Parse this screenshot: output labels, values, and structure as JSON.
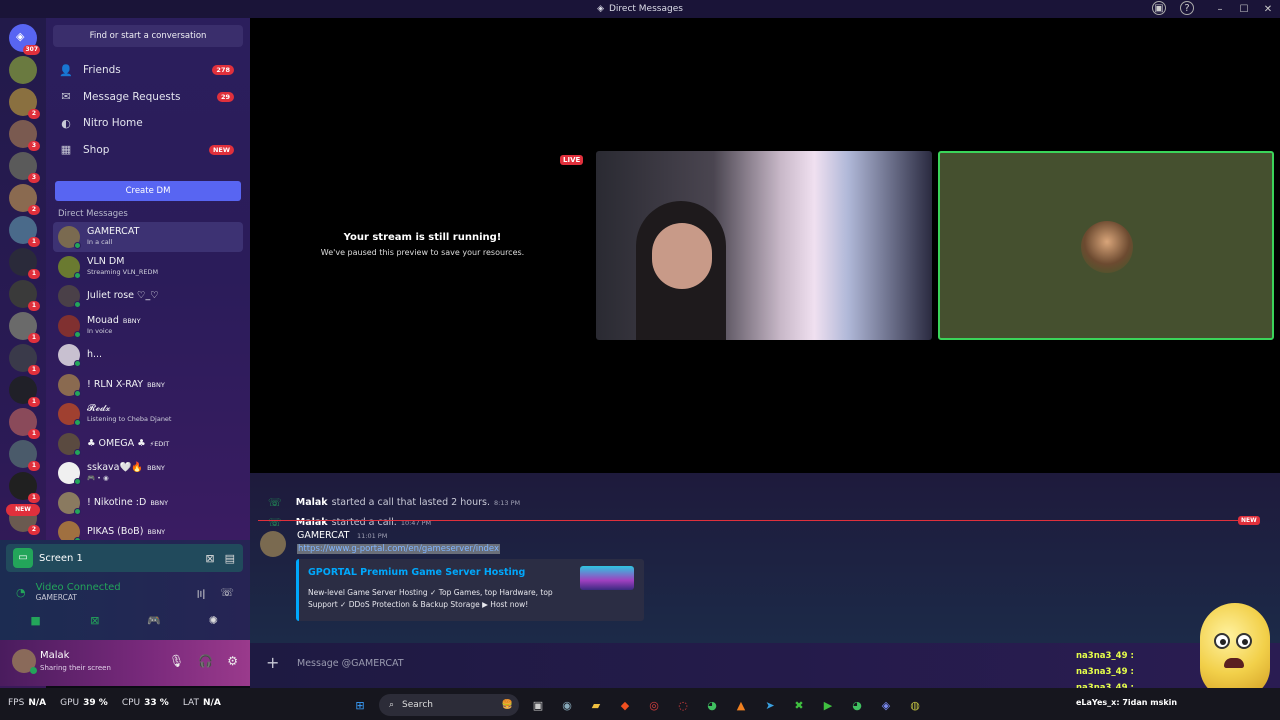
{
  "window": {
    "title": "Direct Messages"
  },
  "rail": {
    "home_badge": "307",
    "servers": [
      {
        "badge": ""
      },
      {
        "badge": "2"
      },
      {
        "badge": "3"
      },
      {
        "badge": "3"
      },
      {
        "badge": "2"
      },
      {
        "badge": "1"
      },
      {
        "badge": "1"
      },
      {
        "badge": "1"
      },
      {
        "badge": "1"
      },
      {
        "badge": "1"
      },
      {
        "badge": "1"
      },
      {
        "badge": "1"
      },
      {
        "badge": "1"
      },
      {
        "badge": "1"
      },
      {
        "badge": "2"
      }
    ],
    "new_label": "NEW"
  },
  "sidebar": {
    "search_label": "Find or start a conversation",
    "nav": [
      {
        "label": "Friends",
        "icon": "friends-icon",
        "badge": "278"
      },
      {
        "label": "Message Requests",
        "icon": "mail-icon",
        "badge": "29"
      },
      {
        "label": "Nitro Home",
        "icon": "nitro-icon",
        "badge": ""
      },
      {
        "label": "Shop",
        "icon": "shop-icon",
        "badge": "NEW"
      }
    ],
    "create_dm": "Create DM",
    "dm_header": "Direct Messages",
    "dms": [
      {
        "name": "GAMERCAT",
        "sub": "In a call",
        "tag": "",
        "color": "#7a6a50"
      },
      {
        "name": "VLN DM",
        "sub": "Streaming VLN_REDM",
        "tag": "",
        "color": "#6a7a30"
      },
      {
        "name": "Juliet rose ♡_♡",
        "sub": "",
        "tag": "",
        "color": "#4a4048"
      },
      {
        "name": "Mouad",
        "sub": "In voice",
        "tag": "BBNY",
        "color": "#803030"
      },
      {
        "name": "h...",
        "sub": "",
        "tag": "",
        "color": "#c8c0d0"
      },
      {
        "name": "! RLN X-RAY",
        "sub": "",
        "tag": "BBNY",
        "color": "#8a6a50"
      },
      {
        "name": "𝓡𝓮𝓭𝔁",
        "sub": "Listening to Cheba Djanet",
        "tag": "",
        "color": "#a04030"
      },
      {
        "name": "♣ OMEGA ♣",
        "sub": "",
        "tag": "⚡EDIT",
        "color": "#5a4a40"
      },
      {
        "name": "sskava🤍🔥",
        "sub": "🎮 • ◉",
        "tag": "BBNY",
        "color": "#f0f0f0"
      },
      {
        "name": "! Nikotine :D",
        "sub": "",
        "tag": "BBNY",
        "color": "#8a7a60"
      },
      {
        "name": "PIKAS (BoB)",
        "sub": "",
        "tag": "BBNY",
        "color": "#a07040"
      }
    ]
  },
  "voice": {
    "screen_label": "Screen 1",
    "status": "Video Connected",
    "channel": "GAMERCAT"
  },
  "user": {
    "name": "Malak",
    "status": "Sharing their screen"
  },
  "stage": {
    "paused_title": "Your stream is still running!",
    "paused_sub": "We've paused this preview to save your resources.",
    "live_label": "LIVE"
  },
  "chat": {
    "system": [
      {
        "name": "Malak",
        "text": "started a call that lasted 2 hours.",
        "time": "8:13 PM"
      },
      {
        "name": "Malak",
        "text": "started a call.",
        "time": "10:47 PM"
      }
    ],
    "new_label": "NEW",
    "message": {
      "author": "GAMERCAT",
      "time": "11:01 PM",
      "link": "https://www.g-portal.com/en/gameserver/index",
      "embed_title": "GPORTAL Premium Game Server Hosting",
      "embed_desc": "New-level Game Server Hosting ✓ Top Games, top Hardware, top Support ✓ DDoS Protection & Backup Storage ▶ Host now!"
    },
    "placeholder": "Message @GAMERCAT"
  },
  "overlay_feed": [
    "na3na3_49 :",
    "na3na3_49 :",
    "na3na3_49 :"
  ],
  "taskbar": {
    "fps_label": "FPS",
    "fps": "N/A",
    "gpu_label": "GPU",
    "gpu": "39 %",
    "cpu_label": "CPU",
    "cpu": "33 %",
    "lat_label": "LAT",
    "lat": "N/A",
    "search": "Search",
    "ticker": "eLaYes_x: 7idan mskin"
  }
}
